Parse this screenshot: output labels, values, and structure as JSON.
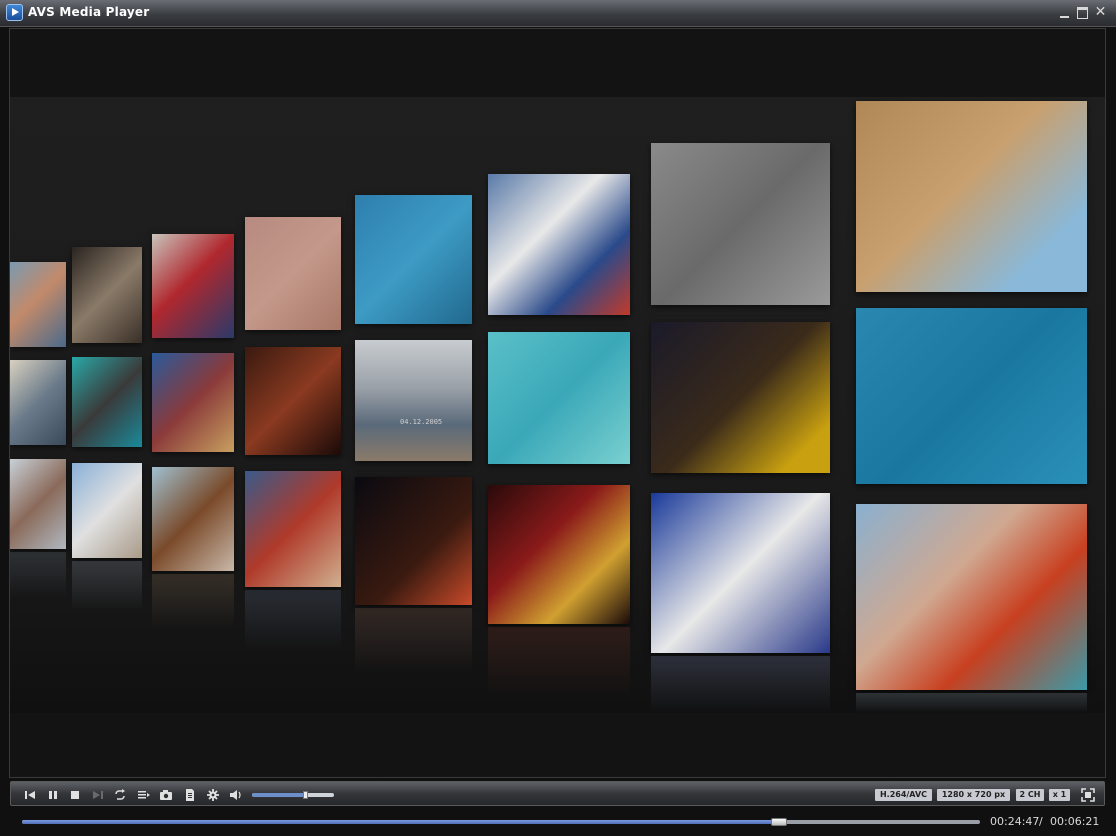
{
  "window": {
    "title": "AVS Media Player"
  },
  "playback": {
    "current_time": "00:24:47",
    "separator": "/",
    "total_time": "00:06:21",
    "progress": 0.79,
    "volume": 0.65
  },
  "media_info": {
    "codec": "H.264/AVC",
    "resolution": "1280 x 720 px",
    "channels": "2 CH",
    "speed": "x 1"
  },
  "video": {
    "watermark_text": "04.12.2005"
  },
  "controls": [
    {
      "name": "previous-button",
      "icon": "skip-back-icon"
    },
    {
      "name": "pause-button",
      "icon": "pause-icon"
    },
    {
      "name": "stop-button",
      "icon": "stop-icon"
    },
    {
      "name": "next-button",
      "icon": "skip-forward-icon"
    },
    {
      "name": "repeat-button",
      "icon": "repeat-icon"
    },
    {
      "name": "playlist-button",
      "icon": "playlist-icon"
    },
    {
      "name": "snapshot-button",
      "icon": "camera-icon"
    },
    {
      "name": "document-button",
      "icon": "document-icon"
    },
    {
      "name": "settings-button",
      "icon": "gear-icon"
    },
    {
      "name": "volume-button",
      "icon": "speaker-icon"
    }
  ],
  "colors": {
    "accent": "#6d8fc9",
    "titlebar": "#3a3d42",
    "background": "#101010"
  }
}
